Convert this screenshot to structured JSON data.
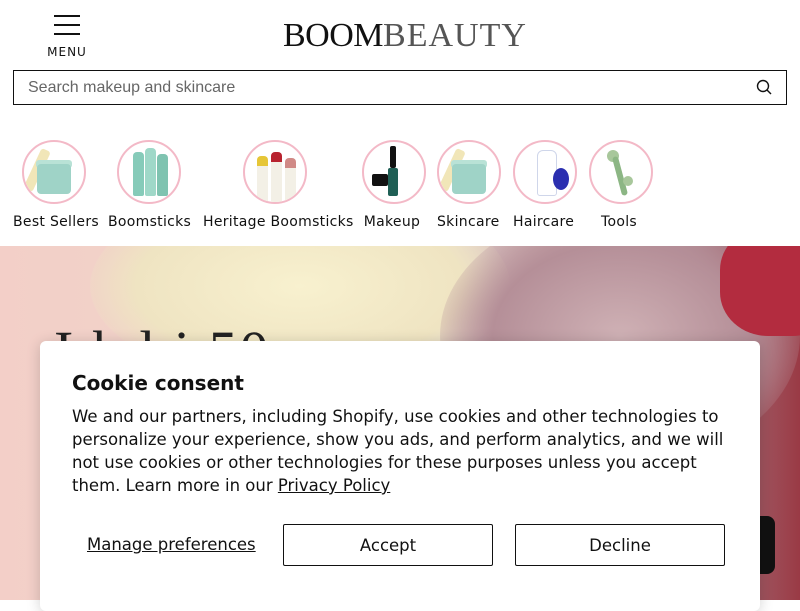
{
  "header": {
    "menu_label": "MENU",
    "logo_bold": "BOOM",
    "logo_light": "BEAUTY"
  },
  "search": {
    "placeholder": "Search makeup and skincare"
  },
  "categories": [
    {
      "label": "Best Sellers"
    },
    {
      "label": "Boomsticks"
    },
    {
      "label": "Heritage Boomsticks"
    },
    {
      "label": "Makeup"
    },
    {
      "label": "Skincare"
    },
    {
      "label": "Haircare"
    },
    {
      "label": "Tools"
    }
  ],
  "hero": {
    "headline_partial": "I    k       l     i        50"
  },
  "cookie": {
    "title": "Cookie consent",
    "body": "We and our partners, including Shopify, use cookies and other technologies to personalize your experience, show you ads, and perform analytics, and we will not use cookies or other technologies for these purposes unless you accept them. Learn more in our ",
    "privacy_link": "Privacy Policy",
    "manage_label": "Manage preferences",
    "accept_label": "Accept",
    "decline_label": "Decline"
  },
  "colors": {
    "category_ring": "#f3b9c7",
    "hero_pink": "#f3cfc8",
    "hero_accent_red": "#b32c3f"
  }
}
